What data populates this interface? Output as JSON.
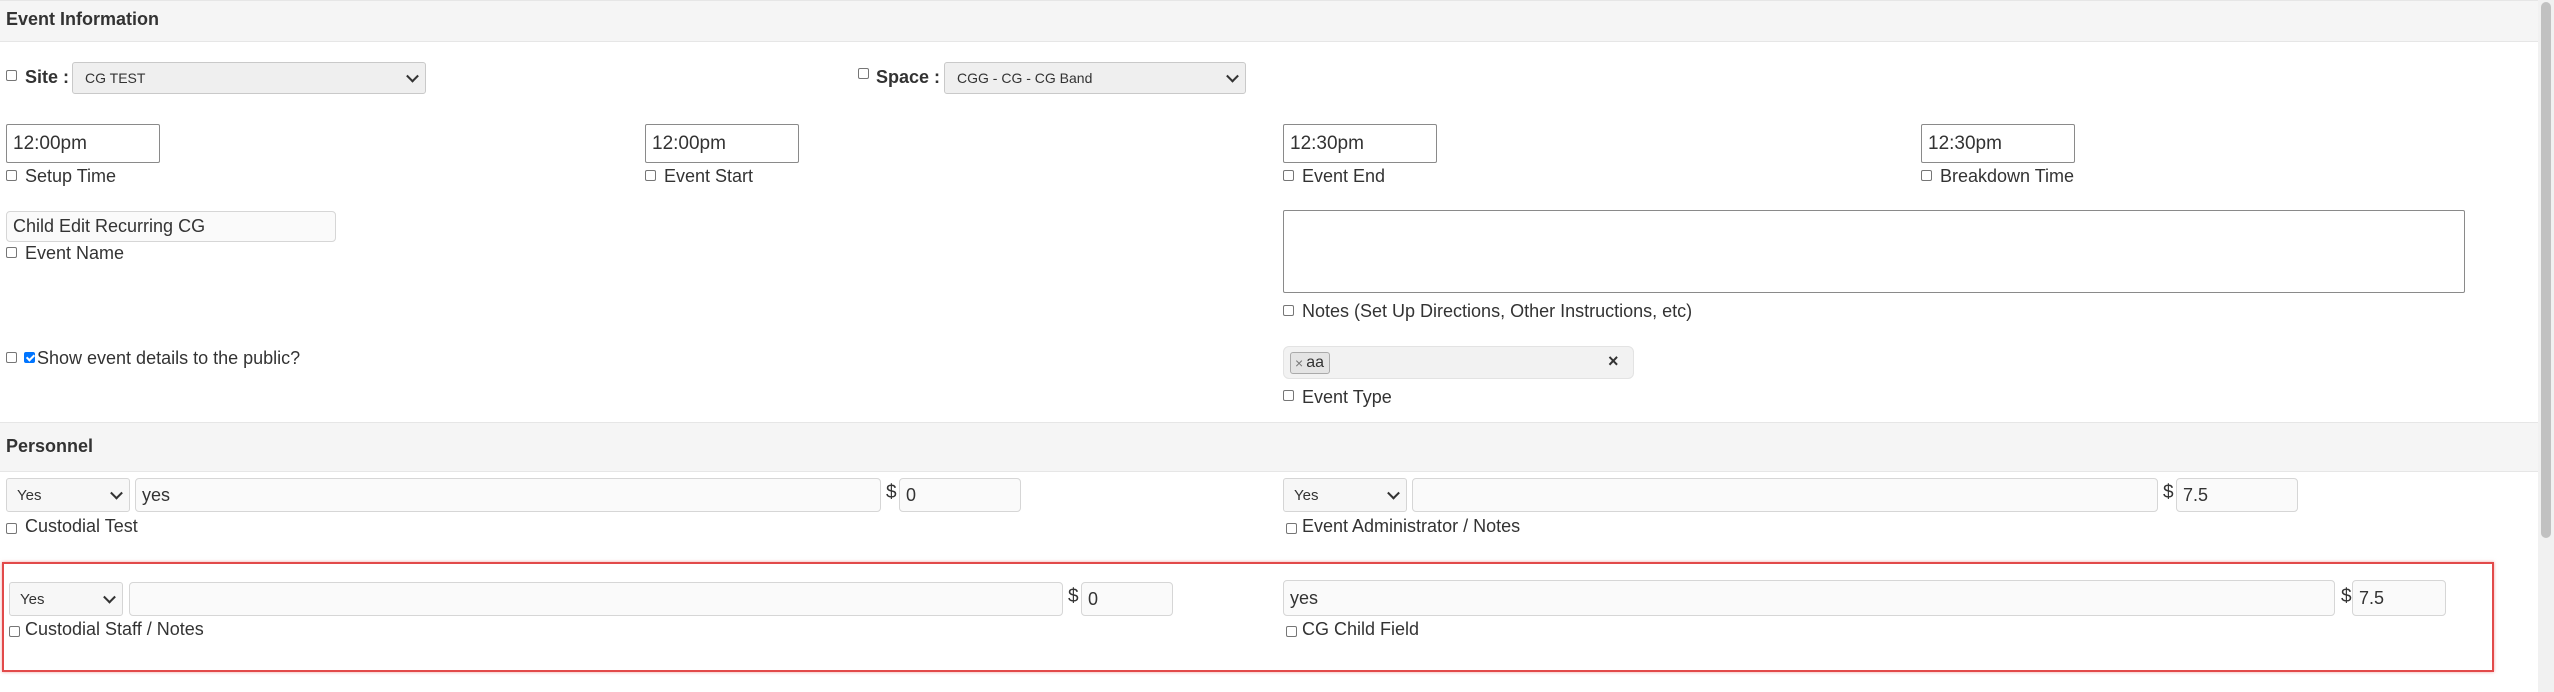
{
  "sections": {
    "event_information": "Event Information",
    "personnel": "Personnel"
  },
  "site": {
    "label": "Site :",
    "value": "CG TEST"
  },
  "space": {
    "label": "Space :",
    "value": "CGG - CG - CG Band"
  },
  "times": {
    "setup": {
      "value": "12:00pm",
      "label": "Setup Time"
    },
    "event_start": {
      "value": "12:00pm",
      "label": "Event Start"
    },
    "event_end": {
      "value": "12:30pm",
      "label": "Event End"
    },
    "breakdown": {
      "value": "12:30pm",
      "label": "Breakdown Time"
    }
  },
  "event_name": {
    "value": "Child Edit Recurring CG",
    "label": "Event Name"
  },
  "notes": {
    "value": "",
    "label": "Notes (Set Up Directions, Other Instructions, etc)"
  },
  "public": {
    "label": "Show event details to the public?",
    "checked": true
  },
  "event_type": {
    "tag": "aa",
    "tag_remove": "×",
    "clear": "×",
    "label": "Event Type"
  },
  "personnel": {
    "custodial_test": {
      "select": "Yes",
      "notes": "yes",
      "currency": "$",
      "amount": "0",
      "label": "Custodial Test"
    },
    "event_admin": {
      "select": "Yes",
      "notes": "",
      "currency": "$",
      "amount": "7.5",
      "label": "Event Administrator / Notes"
    },
    "custodial_staff": {
      "select": "Yes",
      "notes": "",
      "currency": "$",
      "amount": "0",
      "label": "Custodial Staff / Notes"
    },
    "cg_child": {
      "notes": "yes",
      "currency": "$",
      "amount": "7.5",
      "label": "CG Child Field"
    }
  },
  "colors": {
    "highlight": "#e24a4a",
    "section_bg": "#f5f5f5",
    "checkbox_checked": "#0075ff"
  }
}
